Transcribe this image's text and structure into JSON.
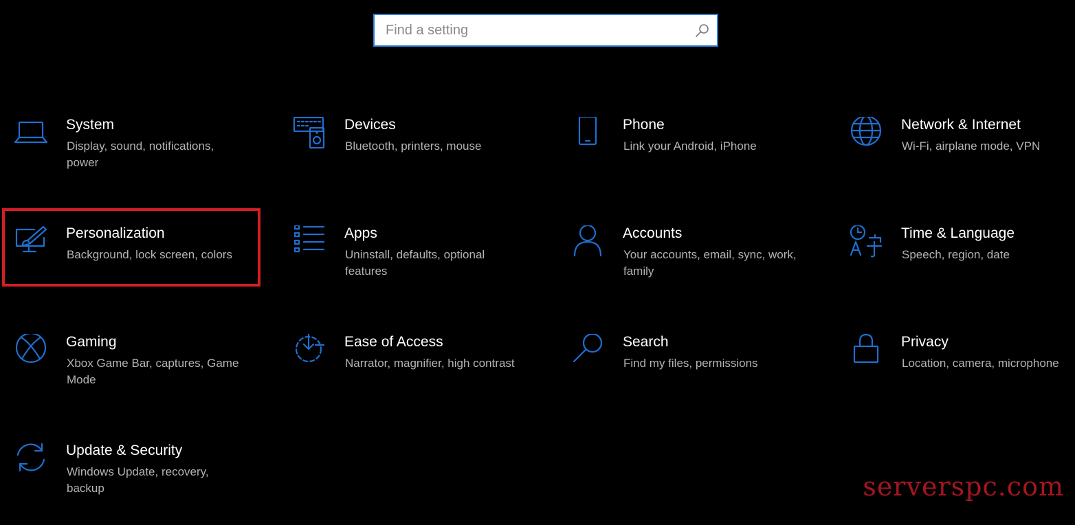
{
  "search": {
    "placeholder": "Find a setting",
    "value": ""
  },
  "tiles": [
    {
      "title": "System",
      "desc": "Display, sound, notifications, power"
    },
    {
      "title": "Devices",
      "desc": "Bluetooth, printers, mouse"
    },
    {
      "title": "Phone",
      "desc": "Link your Android, iPhone"
    },
    {
      "title": "Network & Internet",
      "desc": "Wi-Fi, airplane mode, VPN"
    },
    {
      "title": "Personalization",
      "desc": "Background, lock screen, colors"
    },
    {
      "title": "Apps",
      "desc": "Uninstall, defaults, optional features"
    },
    {
      "title": "Accounts",
      "desc": "Your accounts, email, sync, work, family"
    },
    {
      "title": "Time & Language",
      "desc": "Speech, region, date"
    },
    {
      "title": "Gaming",
      "desc": "Xbox Game Bar, captures, Game Mode"
    },
    {
      "title": "Ease of Access",
      "desc": "Narrator, magnifier, high contrast"
    },
    {
      "title": "Search",
      "desc": "Find my files, permissions"
    },
    {
      "title": "Privacy",
      "desc": "Location, camera, microphone"
    },
    {
      "title": "Update & Security",
      "desc": "Windows Update, recovery, backup"
    }
  ],
  "watermark": "serverspc.com",
  "colors": {
    "accent": "#1e6fd0",
    "highlight": "#d51d26",
    "background": "#000000",
    "watermark": "#a51520"
  }
}
